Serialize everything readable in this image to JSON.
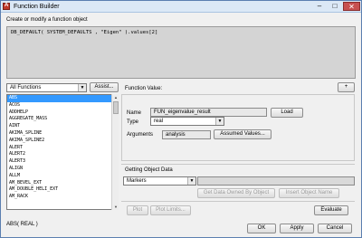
{
  "window": {
    "title": "Function Builder",
    "minimize": "–",
    "maximize": "□",
    "close": "✕",
    "app_icon_letter": "A"
  },
  "prompt": "Create or modify a function object",
  "expression": "DB_DEFAULT( SYSTEM_DEFAULTS , \"Eigen\" ).values[2]",
  "category": {
    "selected": "All Functions",
    "assist_label": "Assist..."
  },
  "functions": [
    "ABS",
    "ACOS",
    "ADDHELP",
    "AGGREGATE_MASS",
    "AINT",
    "AKIMA_SPLINE",
    "AKIMA_SPLINE2",
    "ALERT",
    "ALERT2",
    "ALERT3",
    "ALIGN",
    "ALLM",
    "AM_BEVEL_EXT",
    "AM_DOUBLE_HELI_EXT",
    "AM_RACK"
  ],
  "selected_function_index": 0,
  "function_value": {
    "label": "Function Value:",
    "plus_label": "+"
  },
  "fields": {
    "name_label": "Name",
    "name_value": "FUN_eigenvalue_result",
    "load_label": "Load",
    "type_label": "Type",
    "type_value": "real",
    "arguments_label": "Arguments",
    "arguments_value": "analysis",
    "assumed_values_label": "Assumed Values..."
  },
  "object_data": {
    "heading": "Getting Object Data",
    "object_type": "Markers",
    "get_data_label": "Get Data Owned By Object",
    "insert_name_label": "Insert Object Name"
  },
  "action_buttons": {
    "plot": "Plot",
    "plot_limits": "Plot Limits...",
    "evaluate": "Evaluate"
  },
  "signature": "ABS( REAL )",
  "dialog_buttons": {
    "ok": "OK",
    "apply": "Apply",
    "cancel": "Cancel"
  }
}
